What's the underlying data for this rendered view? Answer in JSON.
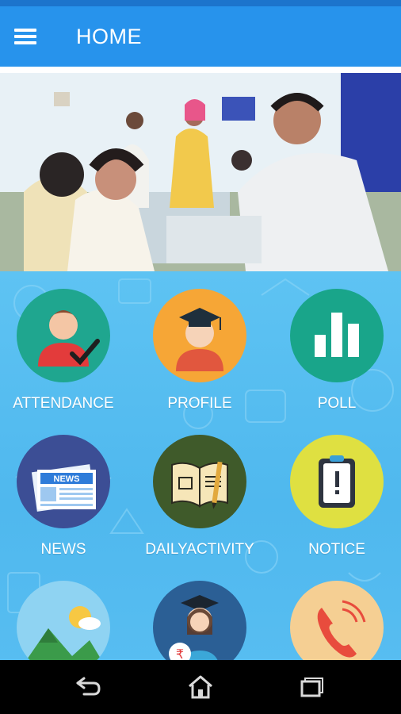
{
  "app_bar": {
    "title": "HOME",
    "menu_icon": "hamburger-menu-icon"
  },
  "banner": {
    "alt": "banner-photo"
  },
  "tiles": [
    {
      "label": "ATTENDANCE",
      "icon": "student-check-icon",
      "color": "#1fa68f"
    },
    {
      "label": "PROFILE",
      "icon": "graduate-icon",
      "color": "#f6a636"
    },
    {
      "label": "POLL",
      "icon": "bar-chart-icon",
      "color": "#19a58a"
    },
    {
      "label": "NEWS",
      "icon": "newspaper-icon",
      "color": "#3c4e95"
    },
    {
      "label": "DAILYACTIVITY",
      "icon": "book-pencil-icon",
      "color": "#3f5a2a"
    },
    {
      "label": "NOTICE",
      "icon": "notice-board-icon",
      "color": "#dfe041"
    },
    {
      "label": "",
      "icon": "landscape-weather-icon",
      "color": "#8fd3f2"
    },
    {
      "label": "",
      "icon": "fees-rupee-graduate-icon",
      "color": "#2b5f95"
    },
    {
      "label": "",
      "icon": "phone-call-icon",
      "color": "#f5cf93"
    }
  ],
  "nav": {
    "back": "back-icon",
    "home": "home-icon",
    "recents": "recents-icon"
  }
}
